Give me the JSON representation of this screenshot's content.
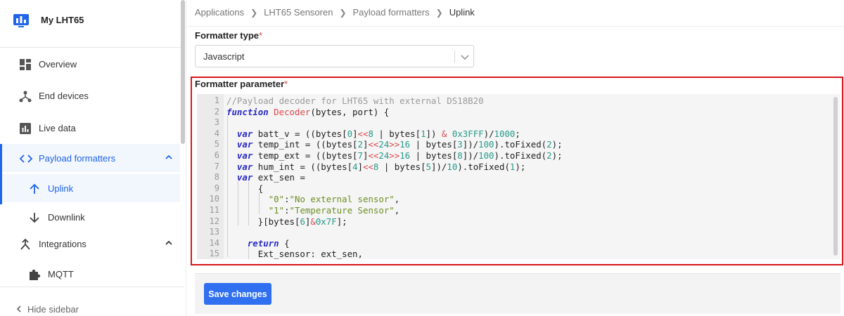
{
  "app": {
    "title": "My LHT65"
  },
  "sidebar": {
    "items": [
      {
        "label": "Overview"
      },
      {
        "label": "End devices"
      },
      {
        "label": "Live data"
      },
      {
        "label": "Payload formatters"
      },
      {
        "label": "Uplink"
      },
      {
        "label": "Downlink"
      },
      {
        "label": "Integrations"
      },
      {
        "label": "MQTT"
      }
    ],
    "hide_label": "Hide sidebar"
  },
  "breadcrumb": [
    "Applications",
    "LHT65 Sensoren",
    "Payload formatters",
    "Uplink"
  ],
  "form": {
    "formatter_type_label": "Formatter type",
    "required_mark": "*",
    "formatter_type_value": "Javascript",
    "formatter_parameter_label": "Formatter parameter",
    "save_label": "Save changes"
  },
  "colors": {
    "accent": "#2065e8",
    "highlight_border": "#d6151b",
    "button": "#2f6ff0"
  },
  "code": {
    "line_numbers": [
      "1",
      "2",
      "3",
      "4",
      "5",
      "6",
      "7",
      "8",
      "9",
      "10",
      "11",
      "12",
      "13",
      "14",
      "15"
    ]
  }
}
